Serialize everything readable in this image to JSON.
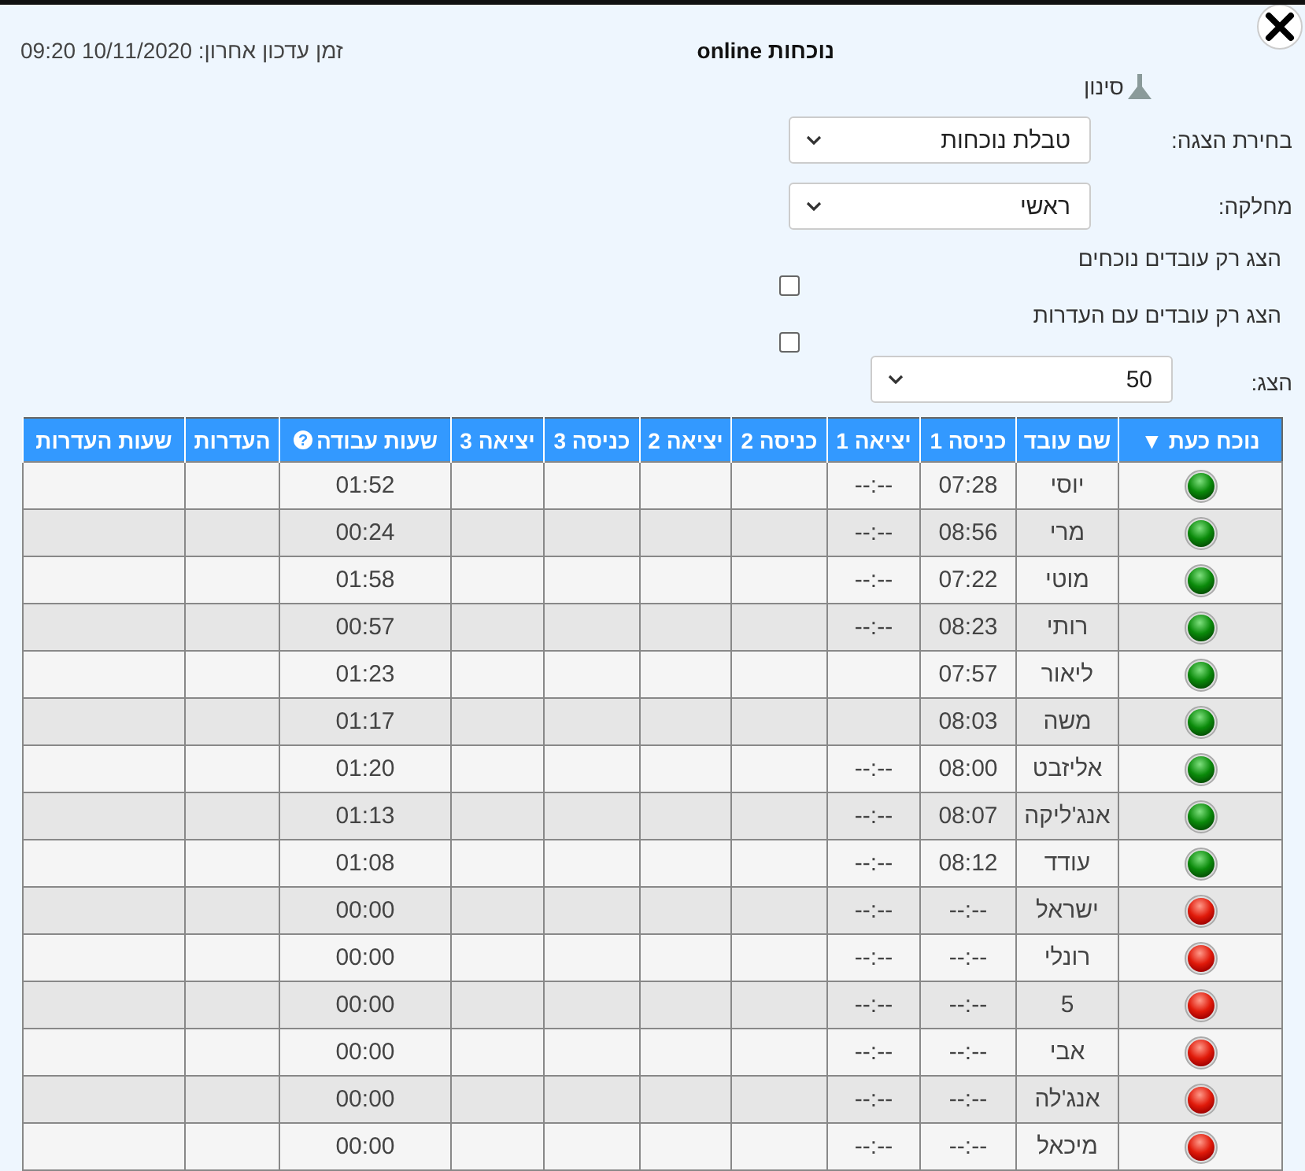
{
  "title": "נוכחות online",
  "last_update": "זמן עדכון אחרון: 10/11/2020 09:20",
  "filter": {
    "label": "סינון"
  },
  "selects": [
    {
      "label": "בחירת הצגה:",
      "value": "טבלת נוכחות"
    },
    {
      "label": "מחלקה:",
      "value": "ראשי"
    }
  ],
  "checkboxes": [
    {
      "label": "הצג רק עובדים נוכחים",
      "checked": false
    },
    {
      "label": "הצג רק עובדים עם העדרות",
      "checked": false
    }
  ],
  "page_size": {
    "label": "הצג:",
    "value": "50"
  },
  "table": {
    "columns": [
      {
        "label": "נוכח כעת ▼"
      },
      {
        "label": "שם עובד"
      },
      {
        "label": "כניסה 1"
      },
      {
        "label": "יציאה 1"
      },
      {
        "label": "כניסה 2"
      },
      {
        "label": "יציאה 2"
      },
      {
        "label": "כניסה 3"
      },
      {
        "label": "יציאה 3"
      },
      {
        "label": "שעות עבודה",
        "help": "?"
      },
      {
        "label": "העדרות"
      },
      {
        "label": "שעות העדרות"
      }
    ],
    "rows": [
      {
        "present": true,
        "name": "יוסי",
        "in_1": "07:28",
        "out_1": "--:--",
        "hours": "01:52"
      },
      {
        "present": true,
        "name": "מרי",
        "in_1": "08:56",
        "out_1": "--:--",
        "hours": "00:24"
      },
      {
        "present": true,
        "name": "מוטי",
        "in_1": "07:22",
        "out_1": "--:--",
        "hours": "01:58"
      },
      {
        "present": true,
        "name": "רותי",
        "in_1": "08:23",
        "out_1": "--:--",
        "hours": "00:57"
      },
      {
        "present": true,
        "name": "ליאור",
        "in_1": "07:57",
        "hours": "01:23"
      },
      {
        "present": true,
        "name": "משה",
        "in_1": "08:03",
        "hours": "01:17"
      },
      {
        "present": true,
        "name": "אליזבט",
        "in_1": "08:00",
        "out_1": "--:--",
        "hours": "01:20"
      },
      {
        "present": true,
        "name": "אנג'ליקה",
        "in_1": "08:07",
        "out_1": "--:--",
        "hours": "01:13"
      },
      {
        "present": true,
        "name": "עודד",
        "in_1": "08:12",
        "out_1": "--:--",
        "hours": "01:08"
      },
      {
        "present": false,
        "name": "ישראל",
        "in_1": "--:--",
        "out_1": "--:--",
        "hours": "00:00"
      },
      {
        "present": false,
        "name": "רונלי",
        "in_1": "--:--",
        "out_1": "--:--",
        "hours": "00:00"
      },
      {
        "present": false,
        "name": "5",
        "in_1": "--:--",
        "out_1": "--:--",
        "hours": "00:00"
      },
      {
        "present": false,
        "name": "אבי",
        "in_1": "--:--",
        "out_1": "--:--",
        "hours": "00:00"
      },
      {
        "present": false,
        "name": "אנג'לה",
        "in_1": "--:--",
        "out_1": "--:--",
        "hours": "00:00"
      },
      {
        "present": false,
        "name": "מיכאל",
        "in_1": "--:--",
        "out_1": "--:--",
        "hours": "00:00"
      }
    ]
  }
}
